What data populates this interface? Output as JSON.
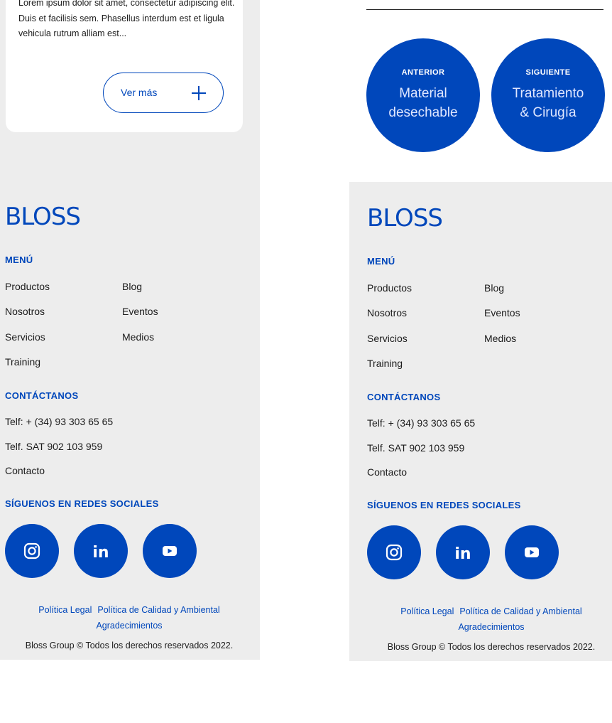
{
  "card": {
    "text": "Lorem ipsum dolor sit amet, consectetur adipiscing elit. Duis et facilisis sem. Phasellus interdum est et ligula vehicula rutrum alliam est...",
    "button_label": "Ver más"
  },
  "nav": {
    "prev": {
      "caption": "ANTERIOR",
      "title": "Material desechable"
    },
    "next": {
      "caption": "SIGUIENTE",
      "title": "Tratamiento & Cirugía"
    }
  },
  "footer": {
    "logo_text": "BLOSS",
    "menu_title": "MENÚ",
    "menu_col1": [
      "Productos",
      "Nosotros",
      "Servicios",
      "Training"
    ],
    "menu_col2": [
      "Blog",
      "Eventos",
      "Medios"
    ],
    "contact_title": "CONTÁCTANOS",
    "contact": [
      "Telf: + (34) 93 303 65 65",
      "Telf. SAT 902 103 959",
      "Contacto"
    ],
    "social_title": "SÍGUENOS EN REDES SOCIALES",
    "social": [
      "instagram-icon",
      "linkedin-icon",
      "youtube-icon"
    ],
    "legal": {
      "legal_link": "Política Legal",
      "quality_link": "Política de Calidad y Ambiental",
      "thanks_link": "Agradecimientos"
    },
    "copyright": "Bloss Group © Todos los derechos reservados 2022."
  },
  "colors": {
    "brand": "#0047bb",
    "footer_bg": "#ededed",
    "text": "#1c1c1c"
  }
}
